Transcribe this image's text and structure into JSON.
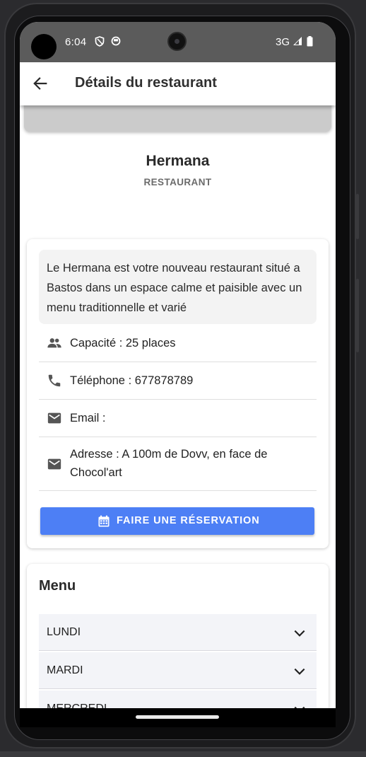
{
  "status_bar": {
    "time": "6:04",
    "network": "3G"
  },
  "app_bar": {
    "title": "Détails du restaurant"
  },
  "restaurant": {
    "name": "Hermana",
    "type": "RESTAURANT",
    "description": "Le Hermana est votre nouveau restaurant situé a Bastos dans un espace calme et paisible avec un menu traditionnelle et varié",
    "capacity": "Capacité : 25 places",
    "phone": "Téléphone : 677878789",
    "email": "Email :",
    "address": "Adresse : A 100m de Dovv, en face de Chocol'art"
  },
  "reserve_button": {
    "label": "FAIRE UNE RÉSERVATION"
  },
  "menu": {
    "title": "Menu",
    "days": [
      "LUNDI",
      "MARDI",
      "MERCREDI"
    ]
  },
  "colors": {
    "primary": "#4d7ff5",
    "status_bar": "#5b5b5b",
    "desc_background": "#f3f3f3",
    "day_background": "#f3f4f8"
  }
}
